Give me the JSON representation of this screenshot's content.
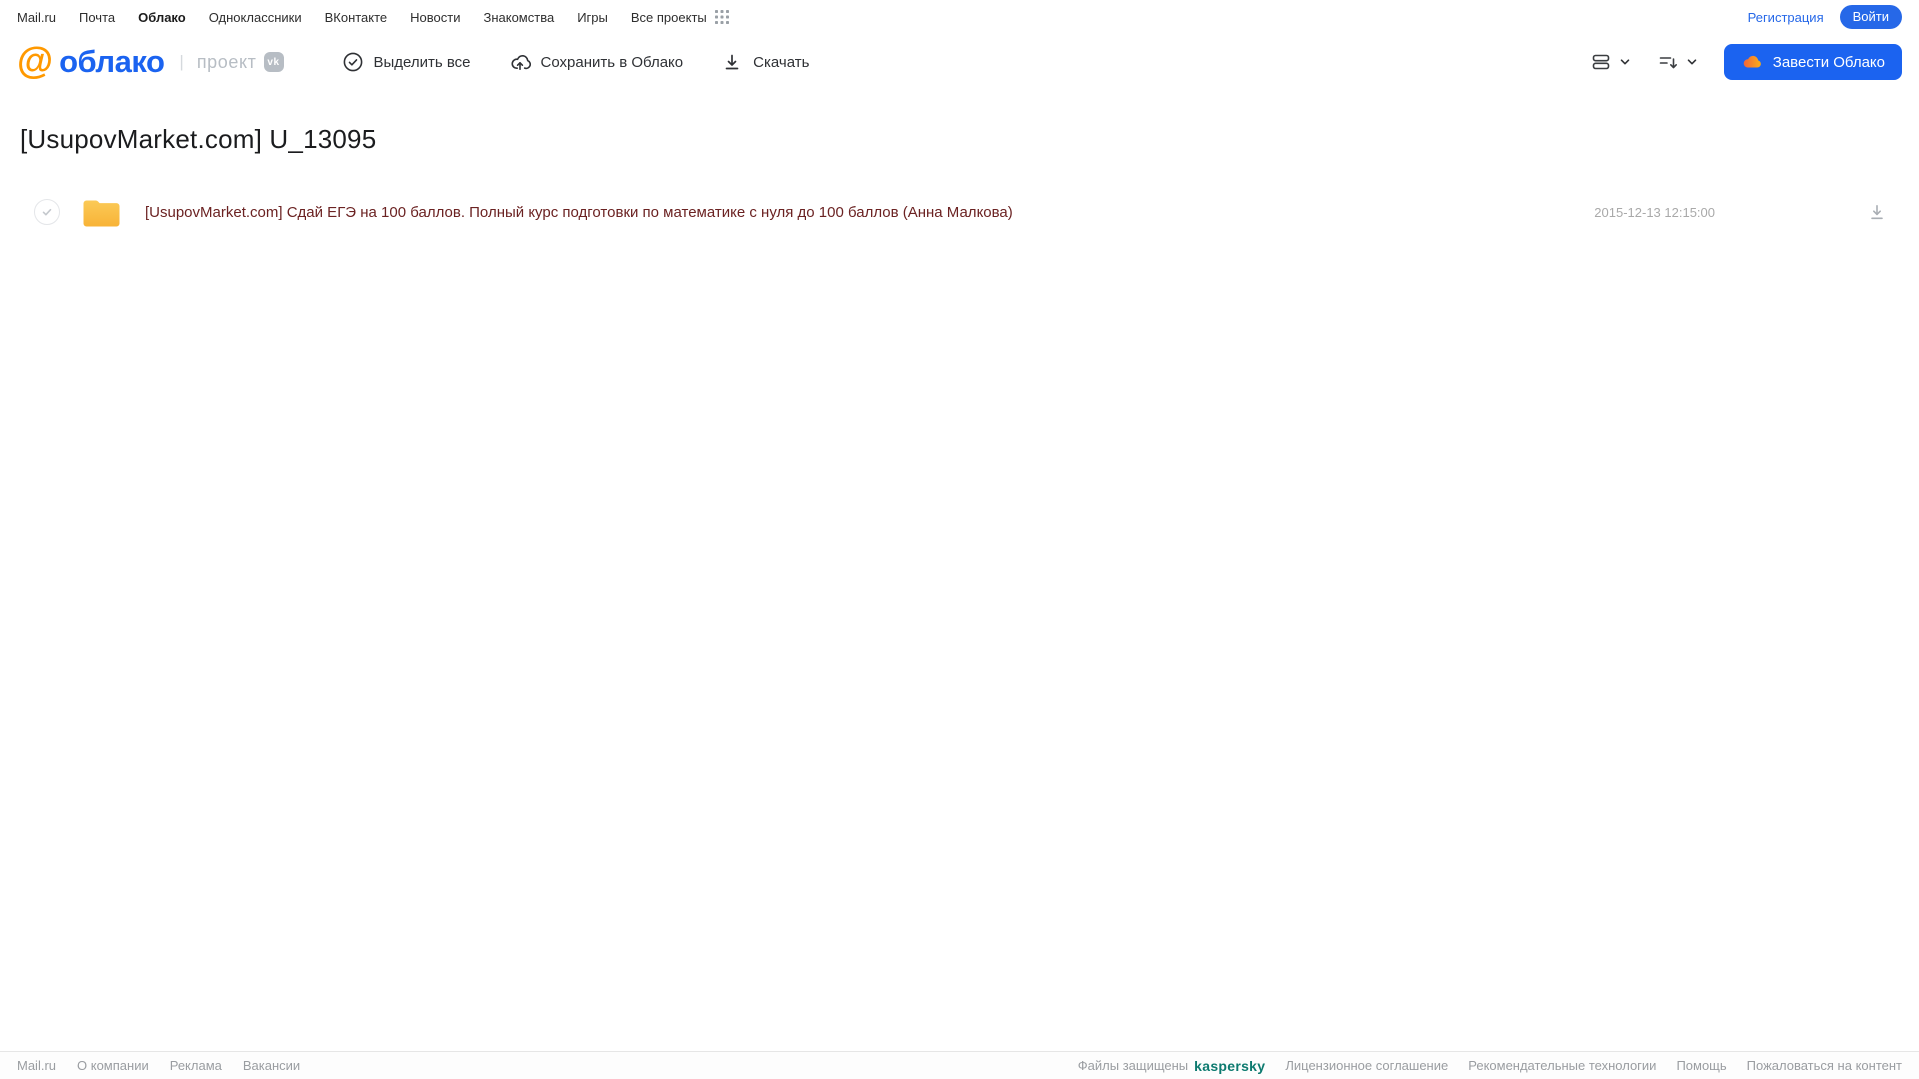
{
  "topnav": {
    "links": [
      "Mail.ru",
      "Почта",
      "Облако",
      "Одноклассники",
      "ВКонтакте",
      "Новости",
      "Знакомства",
      "Игры",
      "Все проекты"
    ],
    "registration": "Регистрация",
    "login": "Войти"
  },
  "header": {
    "logo_at": "@",
    "logo_text": "облако",
    "project_label": "проект",
    "vk_badge": "vk",
    "toolbar": {
      "select_all": "Выделить все",
      "save_to_cloud": "Сохранить в Облако",
      "download": "Скачать"
    },
    "get_cloud_button": "Завести Облако"
  },
  "main": {
    "title": "[UsupovMarket.com] U_13095",
    "files": [
      {
        "name": "[UsupovMarket.com] Сдай ЕГЭ на 100 баллов. Полный курс подготовки по математике с нуля до 100 баллов (Анна Малкова)",
        "date": "2015-12-13 12:15:00"
      }
    ]
  },
  "footer": {
    "left": [
      "Mail.ru",
      "О компании",
      "Реклама",
      "Вакансии"
    ],
    "protected_label": "Файлы защищены",
    "kaspersky": "kaspersky",
    "right": [
      "Лицензионное соглашение",
      "Рекомендательные технологии",
      "Помощь",
      "Пожаловаться на контент"
    ]
  },
  "colors": {
    "accent_blue": "#1b63f0",
    "logo_orange": "#ff9900",
    "folder_yellow": "#f9bd42",
    "kaspersky_teal": "#0d7a6f",
    "file_link": "#6b2222",
    "footer_text": "#9a9da1"
  }
}
